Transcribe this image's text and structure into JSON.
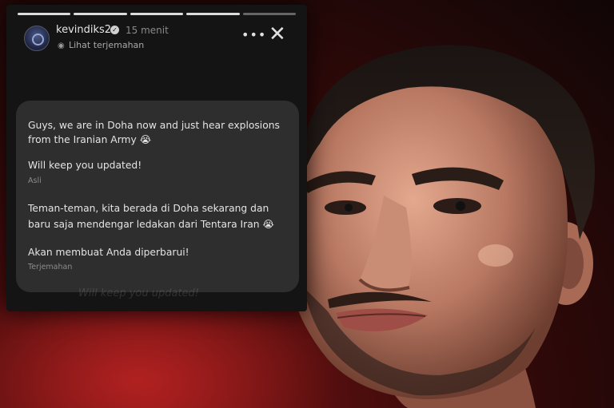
{
  "story": {
    "username": "kevindiks2",
    "time": "15 menit",
    "translate_link": "Lihat terjemahan",
    "more_icon": "•••",
    "close_icon": "✕",
    "verified_icon": "✓",
    "globe_icon": "◉"
  },
  "message": {
    "line1": "Guys, we are in Doha now and just hear explosions",
    "line2": "from the Iranian Army 😭",
    "line3": "Will keep you updated!",
    "label_original": "Asli",
    "line4": "Teman-teman, kita berada di Doha sekarang dan",
    "line5": "baru saja mendengar ledakan dari Tentara Iran 😭",
    "line6": "Akan membuat Anda diperbarui!",
    "label_translation": "Terjemahan"
  },
  "ghost_text": "Will keep you updated!",
  "colors": {
    "panel": "#141414",
    "card": "#2e2e2e",
    "background_red": "#7a1414"
  }
}
